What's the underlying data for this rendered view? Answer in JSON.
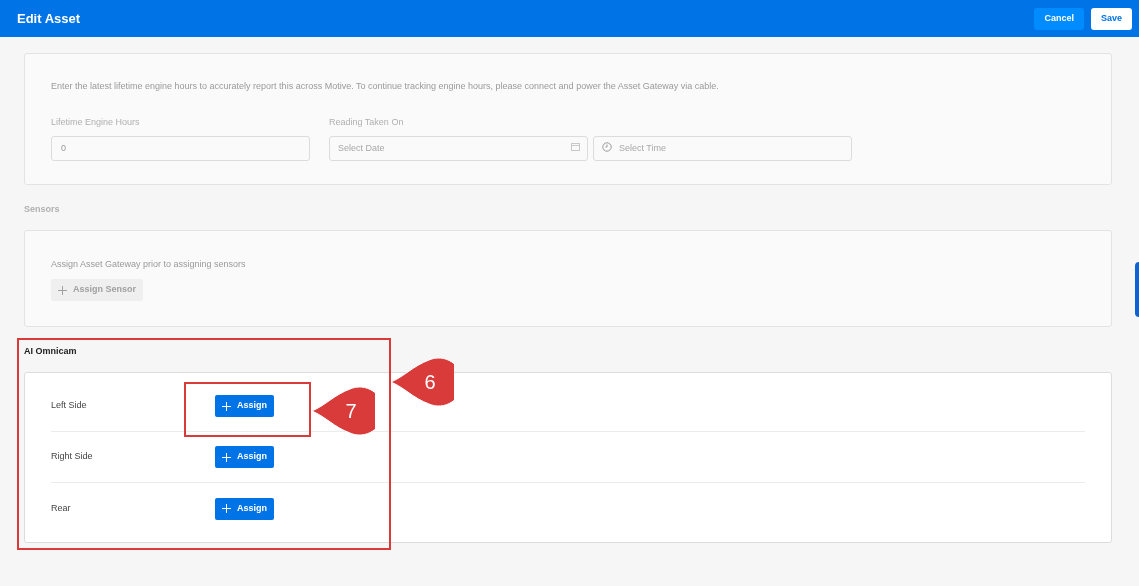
{
  "header": {
    "title": "Edit Asset",
    "buttons": [
      {
        "label": "Cancel",
        "kind": "secondary"
      },
      {
        "label": "Save",
        "kind": "primary"
      }
    ]
  },
  "engine_hours": {
    "note": "Enter the latest lifetime engine hours to accurately report this across Motive. To continue tracking engine hours, please connect and power the Asset Gateway via cable.",
    "hours_label": "Lifetime Engine Hours",
    "hours_value": "0",
    "date_label": "Reading Taken On",
    "date_placeholder": "Select Date",
    "time_placeholder": "Select Time"
  },
  "sensors": {
    "title": "Sensors",
    "note": "Assign Asset Gateway prior to assigning sensors",
    "button": {
      "label": "Assign Sensor",
      "disabled": true
    }
  },
  "omnicam": {
    "title": "AI Omnicam",
    "rows": [
      {
        "label": "Left Side",
        "button": "Assign"
      },
      {
        "label": "Right Side",
        "button": "Assign"
      },
      {
        "label": "Rear",
        "button": "Assign"
      }
    ]
  },
  "annotations": [
    {
      "number": "6"
    },
    {
      "number": "7"
    }
  ]
}
